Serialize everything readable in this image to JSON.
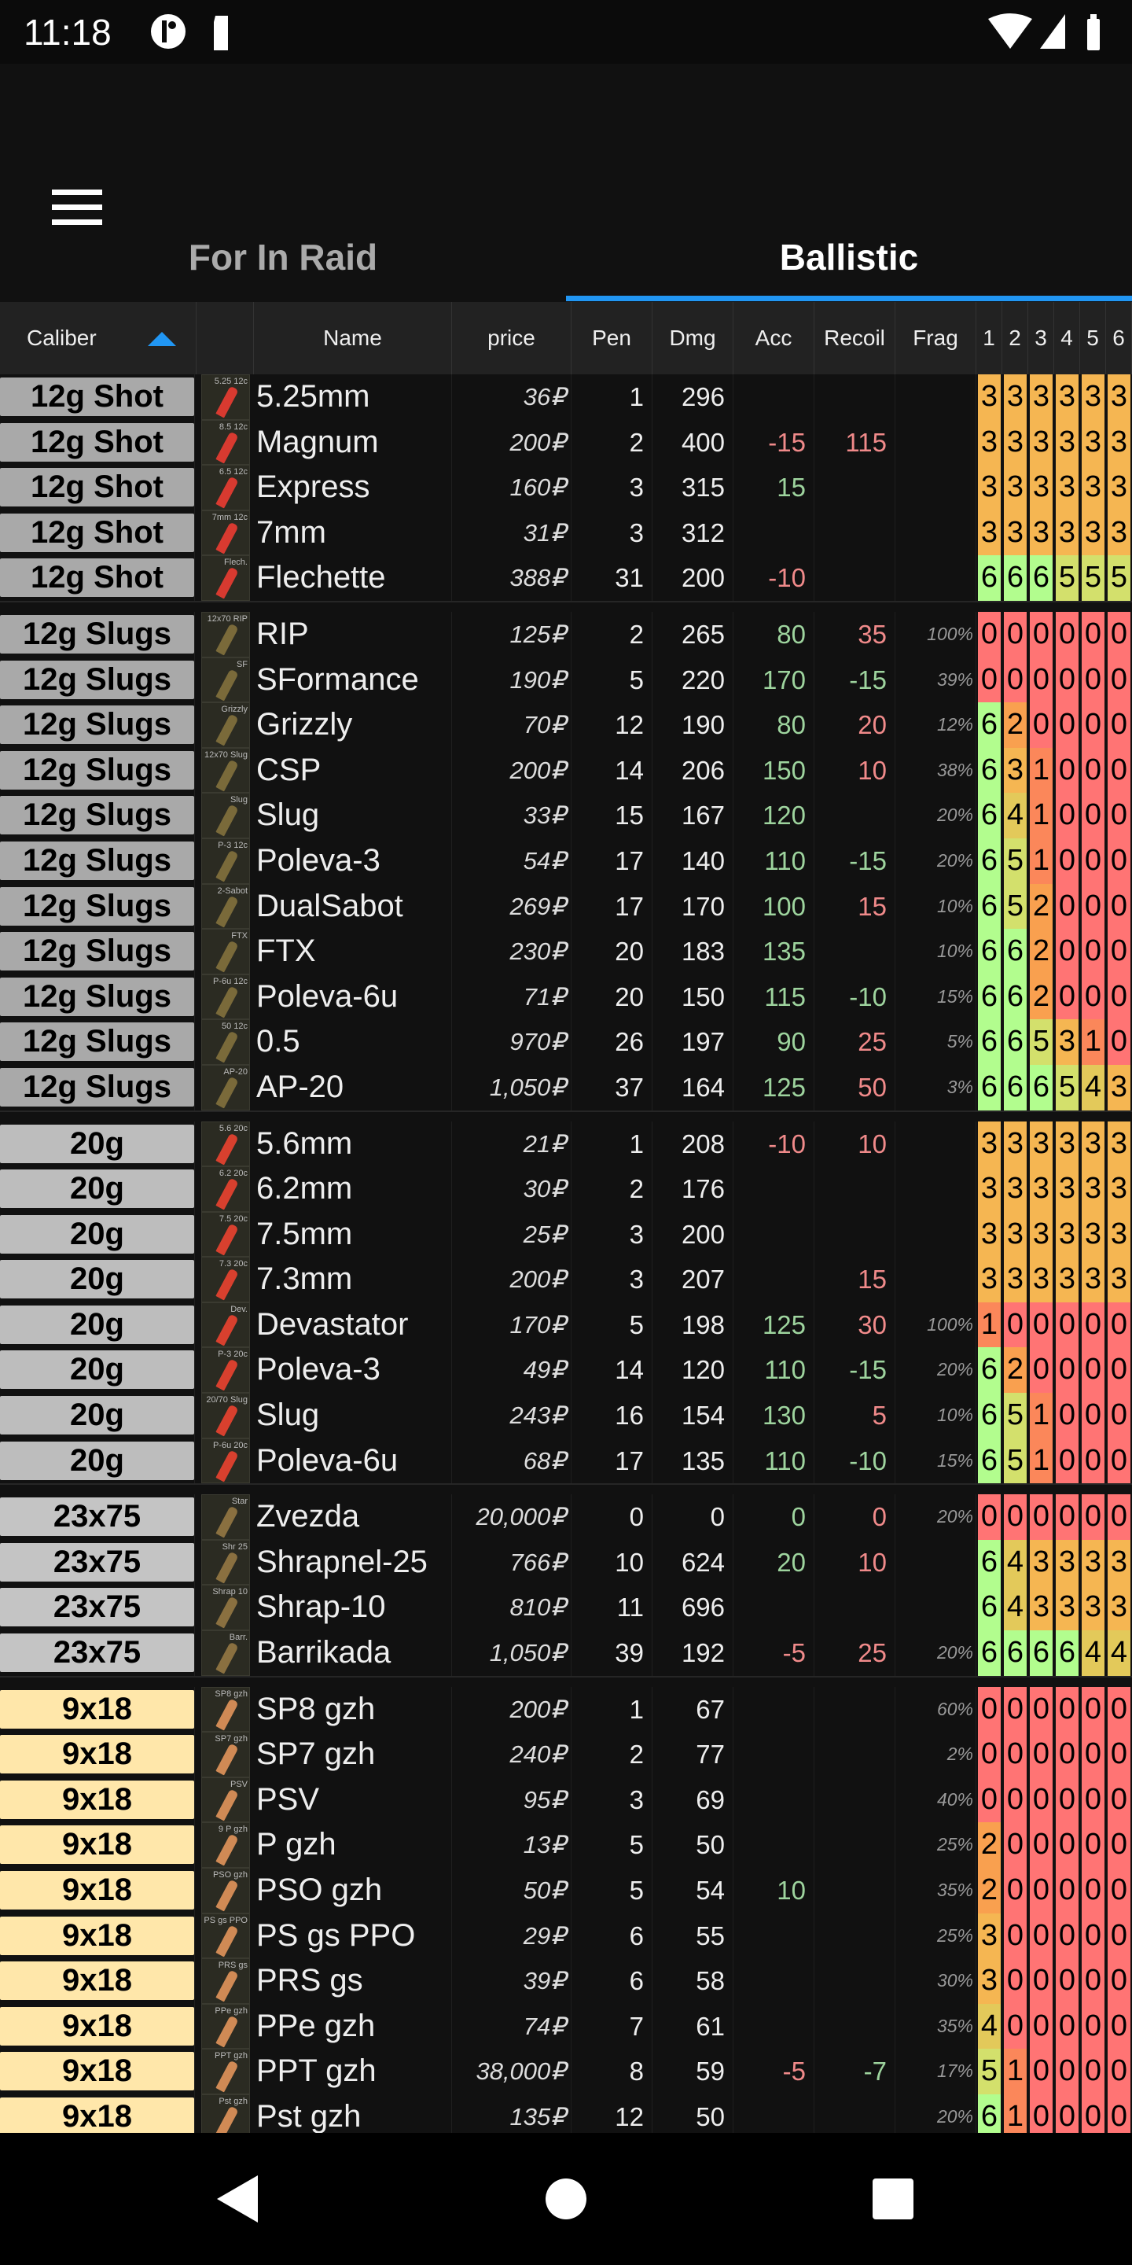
{
  "status": {
    "time": "11:18"
  },
  "tabs": [
    {
      "label": "For In Raid"
    },
    {
      "label": "Ballistic"
    }
  ],
  "accent": "#2196f3",
  "headers": {
    "caliber": "Caliber",
    "name": "Name",
    "price": "price",
    "pen": "Pen",
    "dmg": "Dmg",
    "acc": "Acc",
    "recoil": "Recoil",
    "frag": "Frag",
    "armor": [
      "1",
      "2",
      "3",
      "4",
      "5",
      "6"
    ]
  },
  "sort": {
    "column": "Caliber",
    "direction": "ascending"
  },
  "heat_colors": [
    "#ff7474",
    "#fb875a",
    "#f9a04f",
    "#f5b652",
    "#e3c95a",
    "#d3e06c",
    "#b2fd8e"
  ],
  "groups": [
    {
      "caliber": "12g Shot",
      "color": "#a9a9a9",
      "shell": "#d83a30",
      "rows": [
        [
          "5.25mm",
          "5.25 12c",
          "36₽",
          "1",
          "296",
          "",
          "",
          "",
          [
            3,
            3,
            3,
            3,
            3,
            3
          ]
        ],
        [
          "Magnum",
          "8.5 12c",
          "200₽",
          "2",
          "400",
          "-15",
          "115",
          "",
          [
            3,
            3,
            3,
            3,
            3,
            3
          ]
        ],
        [
          "Express",
          "6.5 12c",
          "160₽",
          "3",
          "315",
          "15",
          "",
          "",
          [
            3,
            3,
            3,
            3,
            3,
            3
          ]
        ],
        [
          "7mm",
          "7mm 12c",
          "31₽",
          "3",
          "312",
          "",
          "",
          "",
          [
            3,
            3,
            3,
            3,
            3,
            3
          ]
        ],
        [
          "Flechette",
          "Flech.",
          "388₽",
          "31",
          "200",
          "-10",
          "",
          "",
          [
            6,
            6,
            6,
            5,
            5,
            5
          ]
        ]
      ]
    },
    {
      "caliber": "12g Slugs",
      "color": "#a9a9a9",
      "shell": "#7a6a3a",
      "rows": [
        [
          "RIP",
          "12x70 RIP",
          "125₽",
          "2",
          "265",
          "80",
          "35",
          "100%",
          [
            0,
            0,
            0,
            0,
            0,
            0
          ]
        ],
        [
          "SFormance",
          "SF",
          "190₽",
          "5",
          "220",
          "170",
          "-15",
          "39%",
          [
            0,
            0,
            0,
            0,
            0,
            0
          ]
        ],
        [
          "Grizzly",
          "Grizzly",
          "70₽",
          "12",
          "190",
          "80",
          "20",
          "12%",
          [
            6,
            2,
            0,
            0,
            0,
            0
          ]
        ],
        [
          "CSP",
          "12x70 Slug",
          "200₽",
          "14",
          "206",
          "150",
          "10",
          "38%",
          [
            6,
            3,
            1,
            0,
            0,
            0
          ]
        ],
        [
          "Slug",
          "Slug",
          "33₽",
          "15",
          "167",
          "120",
          "",
          "20%",
          [
            6,
            4,
            1,
            0,
            0,
            0
          ]
        ],
        [
          "Poleva-3",
          "P-3 12c",
          "54₽",
          "17",
          "140",
          "110",
          "-15",
          "20%",
          [
            6,
            5,
            1,
            0,
            0,
            0
          ]
        ],
        [
          "DualSabot",
          "2-Sabot",
          "269₽",
          "17",
          "170",
          "100",
          "15",
          "10%",
          [
            6,
            5,
            2,
            0,
            0,
            0
          ]
        ],
        [
          "FTX",
          "FTX",
          "230₽",
          "20",
          "183",
          "135",
          "",
          "10%",
          [
            6,
            6,
            2,
            0,
            0,
            0
          ]
        ],
        [
          "Poleva-6u",
          "P-6u 12c",
          "71₽",
          "20",
          "150",
          "115",
          "-10",
          "15%",
          [
            6,
            6,
            2,
            0,
            0,
            0
          ]
        ],
        [
          "0.5",
          "50 12c",
          "970₽",
          "26",
          "197",
          "90",
          "25",
          "5%",
          [
            6,
            6,
            5,
            3,
            1,
            0
          ]
        ],
        [
          "AP-20",
          "AP-20",
          "1,050₽",
          "37",
          "164",
          "125",
          "50",
          "3%",
          [
            6,
            6,
            6,
            5,
            4,
            3
          ]
        ]
      ]
    },
    {
      "caliber": "20g",
      "color": "#bdbdbd",
      "shell": "#d8402e",
      "rows": [
        [
          "5.6mm",
          "5.6 20c",
          "21₽",
          "1",
          "208",
          "-10",
          "10",
          "",
          [
            3,
            3,
            3,
            3,
            3,
            3
          ]
        ],
        [
          "6.2mm",
          "6.2 20c",
          "30₽",
          "2",
          "176",
          "",
          "",
          "",
          [
            3,
            3,
            3,
            3,
            3,
            3
          ]
        ],
        [
          "7.5mm",
          "7.5 20c",
          "25₽",
          "3",
          "200",
          "",
          "",
          "",
          [
            3,
            3,
            3,
            3,
            3,
            3
          ]
        ],
        [
          "7.3mm",
          "7.3 20c",
          "200₽",
          "3",
          "207",
          "",
          "15",
          "",
          [
            3,
            3,
            3,
            3,
            3,
            3
          ]
        ],
        [
          "Devastator",
          "Dev.",
          "170₽",
          "5",
          "198",
          "125",
          "30",
          "100%",
          [
            1,
            0,
            0,
            0,
            0,
            0
          ]
        ],
        [
          "Poleva-3",
          "P-3 20c",
          "49₽",
          "14",
          "120",
          "110",
          "-15",
          "20%",
          [
            6,
            2,
            0,
            0,
            0,
            0
          ]
        ],
        [
          "Slug",
          "20/70 Slug",
          "243₽",
          "16",
          "154",
          "130",
          "5",
          "10%",
          [
            6,
            5,
            1,
            0,
            0,
            0
          ]
        ],
        [
          "Poleva-6u",
          "P-6u 20c",
          "68₽",
          "17",
          "135",
          "110",
          "-10",
          "15%",
          [
            6,
            5,
            1,
            0,
            0,
            0
          ]
        ]
      ]
    },
    {
      "caliber": "23x75",
      "color": "#c4c4c4",
      "shell": "#8a7040",
      "rows": [
        [
          "Zvezda",
          "Star",
          "20,000₽",
          "0",
          "0",
          "0",
          "0",
          "20%",
          [
            0,
            0,
            0,
            0,
            0,
            0
          ]
        ],
        [
          "Shrapnel-25",
          "Shr 25",
          "766₽",
          "10",
          "624",
          "20",
          "10",
          "",
          [
            6,
            4,
            3,
            3,
            3,
            3
          ]
        ],
        [
          "Shrap-10",
          "Shrap 10",
          "810₽",
          "11",
          "696",
          "",
          "",
          "",
          [
            6,
            4,
            3,
            3,
            3,
            3
          ]
        ],
        [
          "Barrikada",
          "Barr.",
          "1,050₽",
          "39",
          "192",
          "-5",
          "25",
          "20%",
          [
            6,
            6,
            6,
            6,
            4,
            4
          ]
        ]
      ]
    },
    {
      "caliber": "9x18",
      "color": "#ffe7aa",
      "shell": "#d08a55",
      "rows": [
        [
          "SP8 gzh",
          "SP8 gzh",
          "200₽",
          "1",
          "67",
          "",
          "",
          "60%",
          [
            0,
            0,
            0,
            0,
            0,
            0
          ]
        ],
        [
          "SP7 gzh",
          "SP7 gzh",
          "240₽",
          "2",
          "77",
          "",
          "",
          "2%",
          [
            0,
            0,
            0,
            0,
            0,
            0
          ]
        ],
        [
          "PSV",
          "PSV",
          "95₽",
          "3",
          "69",
          "",
          "",
          "40%",
          [
            0,
            0,
            0,
            0,
            0,
            0
          ]
        ],
        [
          "P gzh",
          "9 P gzh",
          "13₽",
          "5",
          "50",
          "",
          "",
          "25%",
          [
            2,
            0,
            0,
            0,
            0,
            0
          ]
        ],
        [
          "PSO gzh",
          "PSO gzh",
          "50₽",
          "5",
          "54",
          "10",
          "",
          "35%",
          [
            2,
            0,
            0,
            0,
            0,
            0
          ]
        ],
        [
          "PS gs PPO",
          "PS gs PPO",
          "29₽",
          "6",
          "55",
          "",
          "",
          "25%",
          [
            3,
            0,
            0,
            0,
            0,
            0
          ]
        ],
        [
          "PRS gs",
          "PRS gs",
          "39₽",
          "6",
          "58",
          "",
          "",
          "30%",
          [
            3,
            0,
            0,
            0,
            0,
            0
          ]
        ],
        [
          "PPe gzh",
          "PPe gzh",
          "74₽",
          "7",
          "61",
          "",
          "",
          "35%",
          [
            4,
            0,
            0,
            0,
            0,
            0
          ]
        ],
        [
          "PPT gzh",
          "PPT gzh",
          "38,000₽",
          "8",
          "59",
          "-5",
          "-7",
          "17%",
          [
            5,
            1,
            0,
            0,
            0,
            0
          ]
        ],
        [
          "Pst gzh",
          "Pst gzh",
          "135₽",
          "12",
          "50",
          "",
          "",
          "20%",
          [
            6,
            1,
            0,
            0,
            0,
            0
          ]
        ]
      ]
    }
  ]
}
